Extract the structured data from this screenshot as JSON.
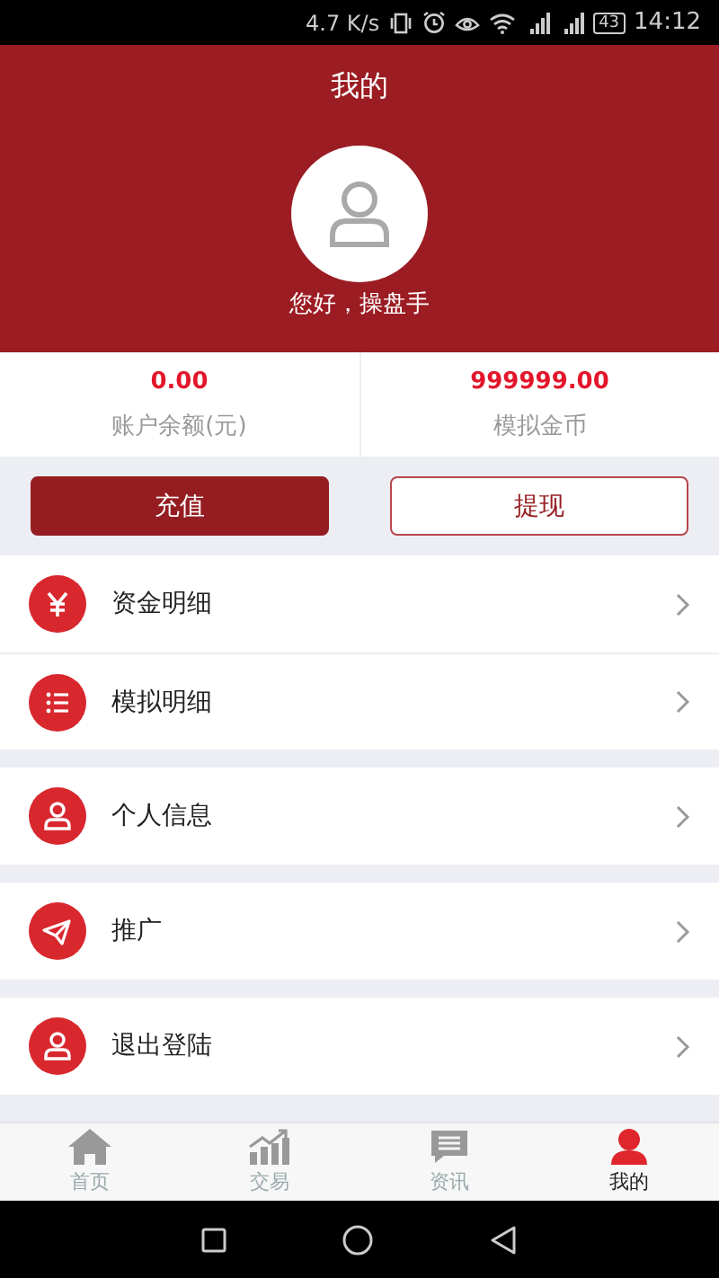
{
  "status_bar": {
    "speed": "4.7 K/s",
    "battery": "43",
    "time": "14:12"
  },
  "header": {
    "title": "我的",
    "greeting": "您好，操盘手"
  },
  "stats": [
    {
      "value": "0.00",
      "label": "账户余额(元)"
    },
    {
      "value": "999999.00",
      "label": "模拟金币"
    }
  ],
  "buttons": [
    {
      "label": "充值",
      "kind": "filled"
    },
    {
      "label": "提现",
      "kind": "outline"
    }
  ],
  "menu_groups": [
    [
      {
        "label": "资金明细"
      },
      {
        "label": "模拟明细"
      }
    ],
    [
      {
        "label": "个人信息"
      }
    ],
    [
      {
        "label": "推广"
      }
    ],
    [
      {
        "label": "退出登陆"
      }
    ]
  ],
  "tab_bar": [
    {
      "label": "首页",
      "selected": false
    },
    {
      "label": "交易",
      "selected": false
    },
    {
      "label": "资讯",
      "selected": false
    },
    {
      "label": "我的",
      "selected": true
    }
  ]
}
